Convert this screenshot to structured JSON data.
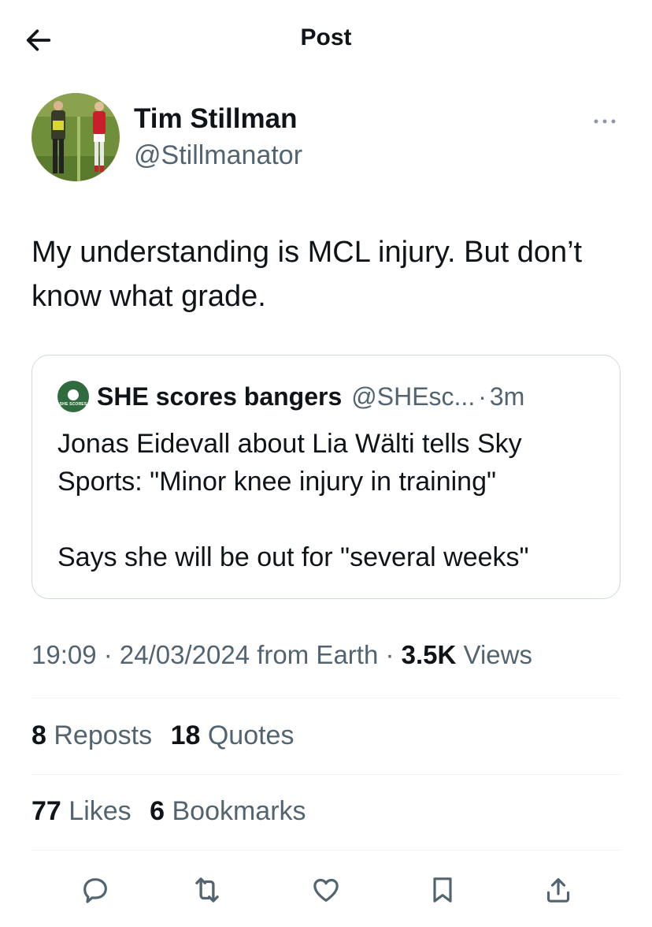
{
  "header": {
    "title": "Post"
  },
  "post": {
    "author": {
      "name": "Tim Stillman",
      "handle": "@Stillmanator"
    },
    "text": "My understanding is MCL injury. But don’t know what grade.",
    "quote": {
      "name": "SHE scores bangers",
      "handle": "@SHEsc...",
      "separator": "·",
      "time": "3m",
      "text": "Jonas Eidevall about Lia Wälti tells Sky Sports: \"Minor knee injury in training\"\n\nSays she will be out for \"several weeks\"",
      "avatar_text": "SHE SCORES"
    },
    "meta": {
      "time": "19:09",
      "sep1": " · ",
      "date": "24/03/2024",
      "source": " from Earth",
      "sep2": " · ",
      "views_count": "3.5K",
      "views_label": " Views"
    },
    "stats": {
      "reposts_count": "8",
      "reposts_label": "Reposts",
      "quotes_count": "18",
      "quotes_label": "Quotes",
      "likes_count": "77",
      "likes_label": "Likes",
      "bookmarks_count": "6",
      "bookmarks_label": "Bookmarks"
    }
  },
  "icons": {
    "back": "arrow-left-icon",
    "more": "more-horizontal-icon",
    "reply": "reply-icon",
    "repost": "repost-icon",
    "like": "heart-icon",
    "bookmark": "bookmark-icon",
    "share": "share-icon"
  },
  "colors": {
    "text": "#0f1419",
    "secondary": "#536471",
    "border": "#cfd9de",
    "divider": "#eff3f4"
  }
}
